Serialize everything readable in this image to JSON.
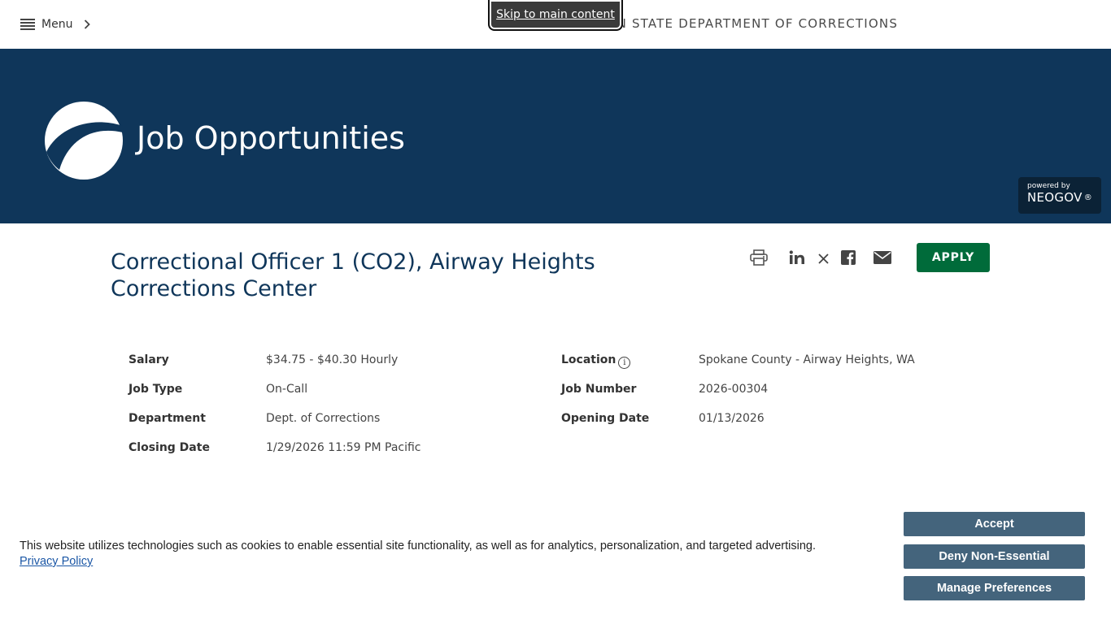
{
  "topbar": {
    "menu_label": "Menu",
    "agency_name": "WASHINGTON STATE DEPARTMENT OF CORRECTIONS",
    "skip_link": "Skip to main content"
  },
  "banner": {
    "title": "Job Opportunities",
    "powered_by": "powered by",
    "vendor": "NEOGOV",
    "vendor_mark": "®"
  },
  "job": {
    "title": "Correctional Officer 1 (CO2), Airway Heights Corrections Center",
    "apply_label": "APPLY",
    "share_icons": [
      "print-icon",
      "linkedin-icon",
      "x-icon",
      "facebook-icon",
      "email-icon"
    ]
  },
  "details": {
    "salary_label": "Salary",
    "salary_value": "$34.75 - $40.30 Hourly",
    "job_type_label": "Job Type",
    "job_type_value": "On-Call",
    "department_label": "Department",
    "department_value": "Dept. of Corrections",
    "closing_label": "Closing Date",
    "closing_value": "1/29/2026 11:59 PM Pacific",
    "location_label": "Location",
    "location_value": "Spokane County - Airway Heights, WA",
    "job_number_label": "Job Number",
    "job_number_value": "2026-00304",
    "opening_label": "Opening Date",
    "opening_value": "01/13/2026"
  },
  "cookie": {
    "text": "This website utilizes technologies such as cookies to enable essential site functionality, as well as for analytics, personalization, and targeted advertising.",
    "privacy_link": "Privacy Policy",
    "accept_label": "Accept",
    "deny_label": "Deny Non-Essential",
    "manage_label": "Manage Preferences"
  },
  "colors": {
    "banner": "#0f365a",
    "apply": "#006b3a",
    "cookie_button": "#44647c",
    "title": "#0f365a"
  }
}
